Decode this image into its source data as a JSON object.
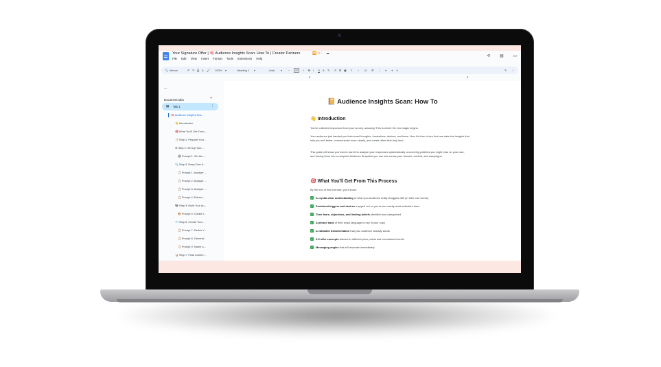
{
  "doc": {
    "title": "Your Signature Offer | 🧠 Audience Insights Scan: How To | Creator Partners",
    "title_icons": "🔀 ☆ 🗀 ☁",
    "menu": [
      "File",
      "Edit",
      "View",
      "Insert",
      "Format",
      "Tools",
      "Extensions",
      "Help"
    ],
    "right_icons": [
      "⟲",
      "▤",
      "▭"
    ]
  },
  "toolbar": {
    "menus": "Menus",
    "zoom": "100%",
    "style": "Heading 1",
    "font": "Arial",
    "size": "22"
  },
  "sidebar": {
    "document_tabs_label": "Document tabs",
    "tab1_label": "Tab 1",
    "items": [
      {
        "label": "🧠 Audience Insights Sca...",
        "active": true
      },
      {
        "label": "👋 Introduction"
      },
      {
        "label": "🎯 What You'll Get From..."
      },
      {
        "label": "📝 Step 1: Prepare Your ..."
      },
      {
        "label": "⚙ Step 2: Set Up Your ..."
      },
      {
        "label": "🖨 Prompt 1: Set the ..."
      },
      {
        "label": "🔍 Step 3: Deep-Dive A..."
      },
      {
        "label": "📋 Prompt 1: Analyze ..."
      },
      {
        "label": "📋 Prompt 2: Analyze ..."
      },
      {
        "label": "📋 Prompt 3: Analyze ..."
      },
      {
        "label": "📋 Prompt 4: Extract ..."
      },
      {
        "label": "🏗 Step 3: Build Your Au..."
      },
      {
        "label": "🎨 Prompt 5: Create t..."
      },
      {
        "label": "💎 Step 5: Create Your..."
      },
      {
        "label": "📋 Prompt 7: Define Y..."
      },
      {
        "label": "📋 Prompt 8: Generat..."
      },
      {
        "label": "📋 Prompt 9: Name a..."
      },
      {
        "label": "📊 Step 7: Final Cohere..."
      }
    ]
  },
  "content": {
    "heading": "📔 Audience Insights Scan: How To",
    "intro_heading": "👋 Introduction",
    "intro_p1": "You've collected responses from your survey, amazing! This is where the real magic begins.",
    "intro_p2": "Your audience just handed you their exact thoughts, frustrations, desires, and fears. Now it's time to turn that raw data into insights that help you sell better, communicate more clearly, and create offers that truly land.",
    "intro_p3": "This guide will show you how to use AI to analyze your responses systematically, uncovering patterns you might miss on your own, and turning them into a complete Audience Snapshot you can use across your funnels, content, and campaigns.",
    "get_heading": "🎯 What You'll Get From This Process",
    "get_intro": "By the end of this exercise, you'll know:",
    "bullets": [
      {
        "bold": "A crystal-clear understanding",
        "rest": " of what your audience really struggles with (in their own words)"
      },
      {
        "bold": "Emotional triggers and desires",
        "rest": " mapped out so you know exactly what motivates them"
      },
      {
        "bold": "Their fears, objections, and limiting beliefs",
        "rest": " identified and categorized"
      },
      {
        "bold": "A phrase bank",
        "rest": " of their exact language to use in your copy"
      },
      {
        "bold": "A validated transformation",
        "rest": " that your audience actually wants"
      },
      {
        "bold": "3-5 offer concepts",
        "rest": " tailored to different price points and commitment levels"
      },
      {
        "bold": "Messaging angles",
        "rest": " that will resonate immediately"
      }
    ]
  }
}
